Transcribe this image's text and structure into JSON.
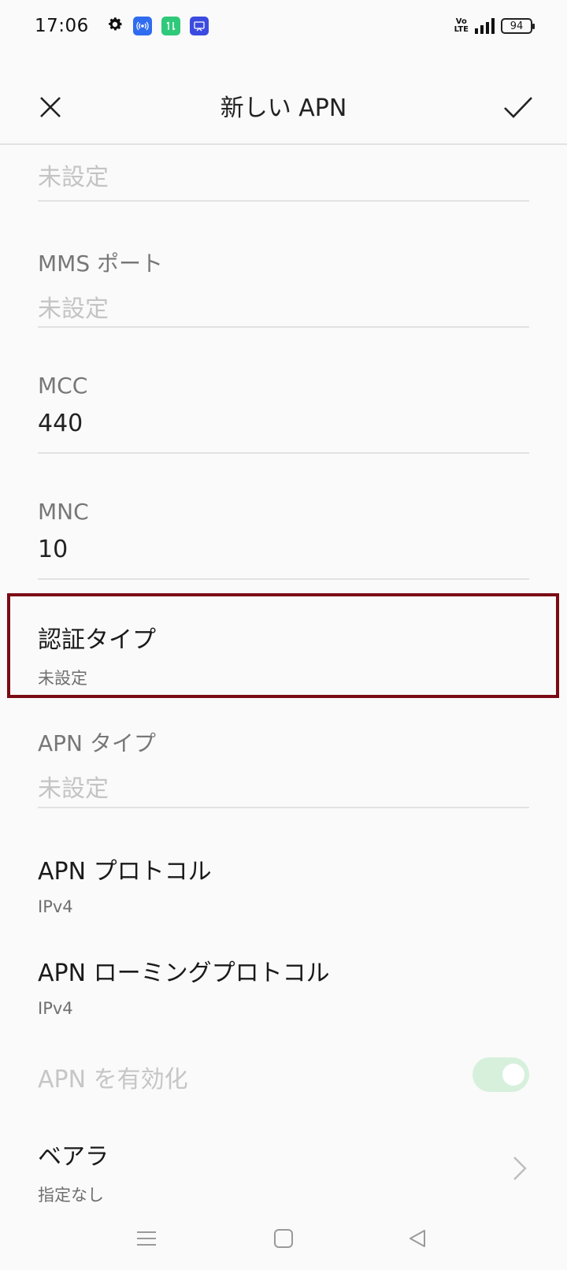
{
  "status_bar": {
    "time": "17:06",
    "icons_left": [
      "gear-icon",
      "hotspot-icon",
      "data-transfer-icon",
      "screen-cast-icon"
    ],
    "volte_top": "Vo",
    "volte_bottom": "LTE",
    "battery": "94"
  },
  "header": {
    "title": "新しい APN"
  },
  "fields": {
    "mms_proxy": {
      "value": "未設定"
    },
    "mms_port": {
      "label": "MMS ポート",
      "value": "未設定"
    },
    "mcc": {
      "label": "MCC",
      "value": "440"
    },
    "mnc": {
      "label": "MNC",
      "value": "10"
    },
    "apn_type": {
      "label": "APN タイプ",
      "value": "未設定"
    }
  },
  "items": {
    "auth_type": {
      "title": "認証タイプ",
      "sub": "未設定"
    },
    "apn_protocol": {
      "title": "APN プロトコル",
      "sub": "IPv4"
    },
    "apn_roaming_protocol": {
      "title": "APN ローミングプロトコル",
      "sub": "IPv4"
    },
    "apn_enable": {
      "title": "APN を有効化",
      "enabled": true
    },
    "bearer": {
      "title": "ベアラ",
      "sub": "指定なし"
    }
  },
  "colors": {
    "highlight_border": "#7a0b14",
    "toggle_on": "#d6f0dc",
    "hotspot_chip": "#2f6cf0",
    "data_chip": "#2fc97a",
    "cast_chip": "#3b4be0"
  }
}
